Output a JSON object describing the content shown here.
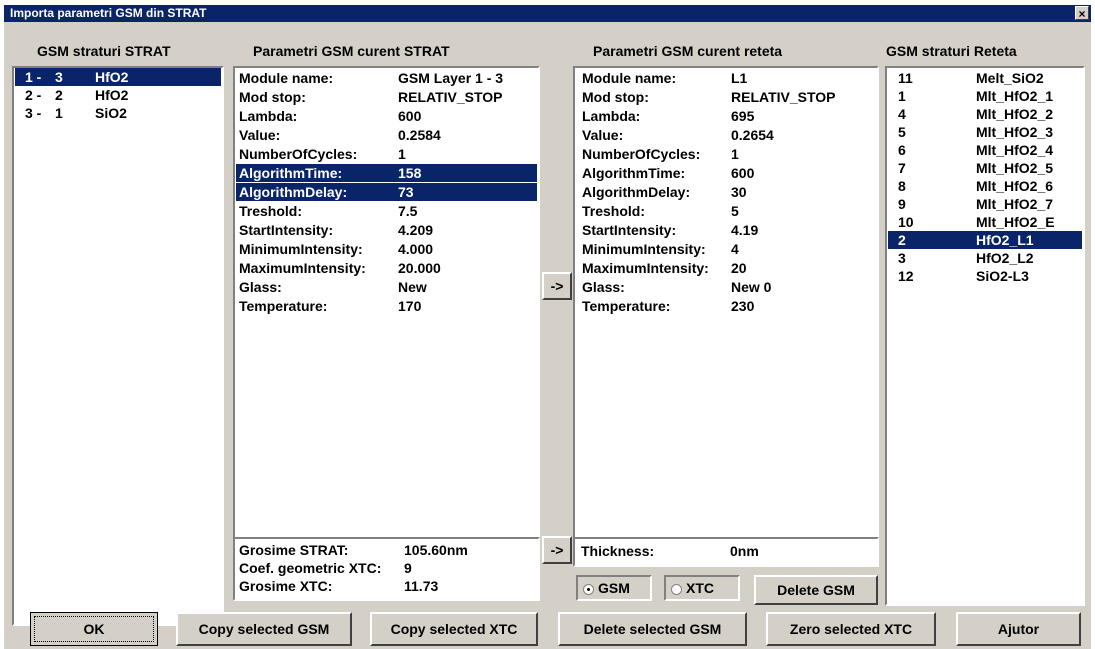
{
  "window": {
    "title": "Importa parametri GSM din STRAT",
    "close_glyph": "×"
  },
  "headers": {
    "strat_layers": "GSM straturi STRAT",
    "strat_params": "Parametri GSM curent STRAT",
    "reteta_params": "Parametri GSM curent reteta",
    "reteta_layers": "GSM straturi Reteta"
  },
  "strat_layers": [
    {
      "num": "1 -",
      "idx": "3",
      "name": "HfO2",
      "selected": true
    },
    {
      "num": "2 -",
      "idx": "2",
      "name": "HfO2",
      "selected": false
    },
    {
      "num": "3 -",
      "idx": "1",
      "name": "SiO2",
      "selected": false
    }
  ],
  "strat_params": [
    {
      "label": "Module name:",
      "value": "GSM Layer 1 - 3",
      "selected": false
    },
    {
      "label": "Mod stop:",
      "value": "RELATIV_STOP",
      "selected": false
    },
    {
      "label": "Lambda:",
      "value": "600",
      "selected": false
    },
    {
      "label": "Value:",
      "value": "0.2584",
      "selected": false
    },
    {
      "label": "NumberOfCycles:",
      "value": "1",
      "selected": false
    },
    {
      "label": "AlgorithmTime:",
      "value": "158",
      "selected": true
    },
    {
      "label": "AlgorithmDelay:",
      "value": "73",
      "selected": true
    },
    {
      "label": "Treshold:",
      "value": "7.5",
      "selected": false
    },
    {
      "label": "StartIntensity:",
      "value": "4.209",
      "selected": false
    },
    {
      "label": "MinimumIntensity:",
      "value": "4.000",
      "selected": false
    },
    {
      "label": "MaximumIntensity:",
      "value": "20.000",
      "selected": false
    },
    {
      "label": "Glass:",
      "value": "New",
      "selected": false
    },
    {
      "label": "Temperature:",
      "value": "170",
      "selected": false
    }
  ],
  "reteta_params": [
    {
      "label": "Module name:",
      "value": "L1"
    },
    {
      "label": "Mod stop:",
      "value": "RELATIV_STOP"
    },
    {
      "label": "Lambda:",
      "value": "695"
    },
    {
      "label": "Value:",
      "value": "0.2654"
    },
    {
      "label": "NumberOfCycles:",
      "value": "1"
    },
    {
      "label": "AlgorithmTime:",
      "value": "600"
    },
    {
      "label": "AlgorithmDelay:",
      "value": "30"
    },
    {
      "label": "Treshold:",
      "value": "5"
    },
    {
      "label": "StartIntensity:",
      "value": "4.19"
    },
    {
      "label": "MinimumIntensity:",
      "value": "4"
    },
    {
      "label": "MaximumIntensity:",
      "value": "20"
    },
    {
      "label": "Glass:",
      "value": "New 0"
    },
    {
      "label": "Temperature:",
      "value": "230"
    }
  ],
  "reteta_layers": [
    {
      "idx": "11",
      "name": "Melt_SiO2",
      "selected": false
    },
    {
      "idx": "1",
      "name": "Mlt_HfO2_1",
      "selected": false
    },
    {
      "idx": "4",
      "name": "Mlt_HfO2_2",
      "selected": false
    },
    {
      "idx": "5",
      "name": "Mlt_HfO2_3",
      "selected": false
    },
    {
      "idx": "6",
      "name": "Mlt_HfO2_4",
      "selected": false
    },
    {
      "idx": "7",
      "name": "Mlt_HfO2_5",
      "selected": false
    },
    {
      "idx": "8",
      "name": "Mlt_HfO2_6",
      "selected": false
    },
    {
      "idx": "9",
      "name": "Mlt_HfO2_7",
      "selected": false
    },
    {
      "idx": "10",
      "name": "Mlt_HfO2_E",
      "selected": false
    },
    {
      "idx": "2",
      "name": "HfO2_L1",
      "selected": true
    },
    {
      "idx": "3",
      "name": "HfO2_L2",
      "selected": false
    },
    {
      "idx": "12",
      "name": "SiO2-L3",
      "selected": false
    }
  ],
  "strat_thickness": [
    {
      "label": "Grosime STRAT:",
      "value": "105.60nm"
    },
    {
      "label": "Coef. geometric XTC:",
      "value": "9"
    },
    {
      "label": "Grosime XTC:",
      "value": "11.73"
    }
  ],
  "reteta_thickness": {
    "label": "Thickness:",
    "value": "0nm"
  },
  "arrows": {
    "params": "->",
    "thickness": "->"
  },
  "mode": {
    "gsm_label": "GSM",
    "xtc_label": "XTC",
    "selected": "GSM",
    "delete_gsm": "Delete GSM"
  },
  "buttons": {
    "ok": "OK",
    "copy_gsm": "Copy selected GSM",
    "copy_xtc": "Copy selected XTC",
    "delete_gsm": "Delete selected GSM",
    "zero_xtc": "Zero selected XTC",
    "help": "Ajutor"
  },
  "colors": {
    "selection": "#0a246a",
    "face": "#d4d0c8",
    "titlebar": "#0a246a"
  }
}
